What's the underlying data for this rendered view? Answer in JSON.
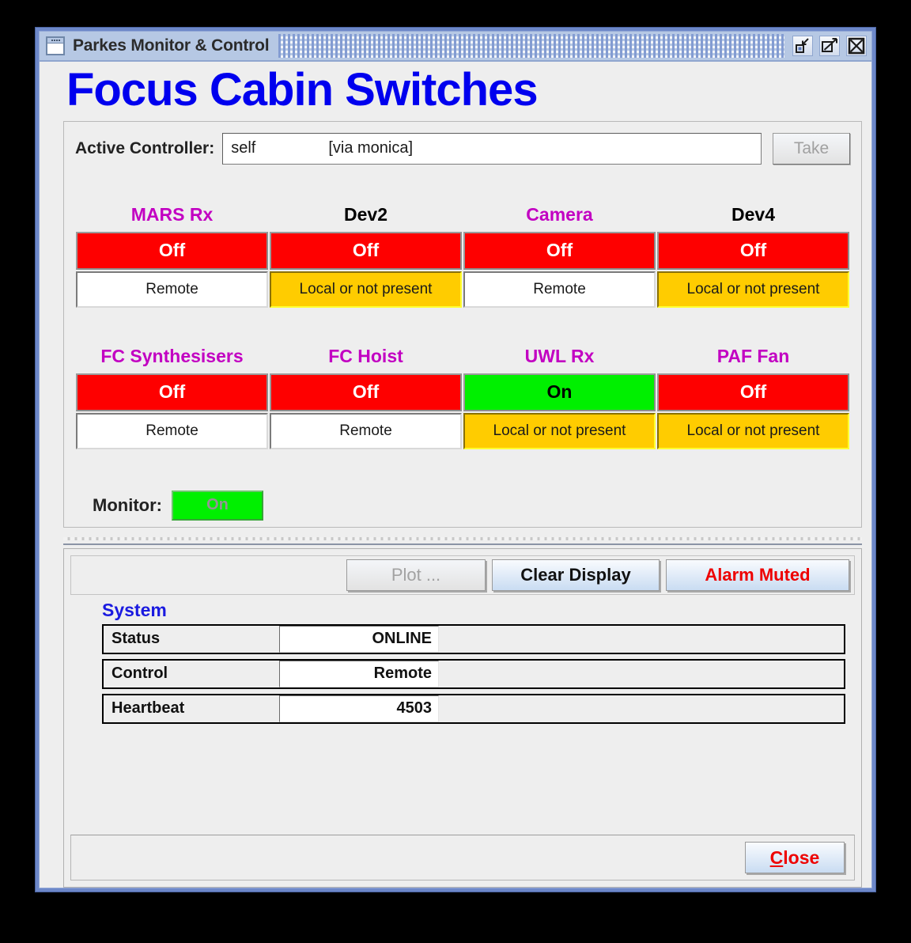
{
  "window": {
    "title": "Parkes Monitor & Control",
    "icon": "window-document-icon",
    "buttons": {
      "minimize": "minimize-icon",
      "maximize": "maximize-icon",
      "close": "close-window-icon"
    }
  },
  "page": {
    "title": "Focus Cabin Switches",
    "title_color": "#0000ee"
  },
  "controller": {
    "label": "Active Controller:",
    "value_name": "self",
    "value_via": "[via monica]",
    "take_button": "Take"
  },
  "devices": {
    "row1": [
      {
        "name": "MARS Rx",
        "name_color": "magenta",
        "state": "Off",
        "state_kind": "off",
        "mode": "Remote",
        "mode_kind": "remote"
      },
      {
        "name": "Dev2",
        "name_color": "black",
        "state": "Off",
        "state_kind": "off",
        "mode": "Local or not present",
        "mode_kind": "local"
      },
      {
        "name": "Camera",
        "name_color": "magenta",
        "state": "Off",
        "state_kind": "off",
        "mode": "Remote",
        "mode_kind": "remote"
      },
      {
        "name": "Dev4",
        "name_color": "black",
        "state": "Off",
        "state_kind": "off",
        "mode": "Local or not present",
        "mode_kind": "local"
      }
    ],
    "row2": [
      {
        "name": "FC Synthesisers",
        "name_color": "magenta",
        "state": "Off",
        "state_kind": "off",
        "mode": "Remote",
        "mode_kind": "remote"
      },
      {
        "name": "FC Hoist",
        "name_color": "magenta",
        "state": "Off",
        "state_kind": "off",
        "mode": "Remote",
        "mode_kind": "remote"
      },
      {
        "name": "UWL Rx",
        "name_color": "magenta",
        "state": "On",
        "state_kind": "on",
        "mode": "Local or not present",
        "mode_kind": "local"
      },
      {
        "name": "PAF Fan",
        "name_color": "magenta",
        "state": "Off",
        "state_kind": "off",
        "mode": "Local or not present",
        "mode_kind": "local"
      }
    ]
  },
  "monitor": {
    "label": "Monitor:",
    "state": "On"
  },
  "toolbar": {
    "plot": "Plot ...",
    "clear_display": "Clear Display",
    "alarm_muted": "Alarm Muted"
  },
  "system": {
    "heading": "System",
    "rows": [
      {
        "key": "Status",
        "value": "ONLINE"
      },
      {
        "key": "Control",
        "value": "Remote"
      },
      {
        "key": "Heartbeat",
        "value": "4503"
      }
    ]
  },
  "footer": {
    "close_mnemonic": "C",
    "close_rest": "lose"
  },
  "colors": {
    "off": "#fe0000",
    "on": "#00f000",
    "local": "#ffcc00",
    "magenta": "#c200c2",
    "alarm": "#ee0000",
    "title_blue": "#0000ee",
    "system_blue": "#1a1ae0"
  }
}
